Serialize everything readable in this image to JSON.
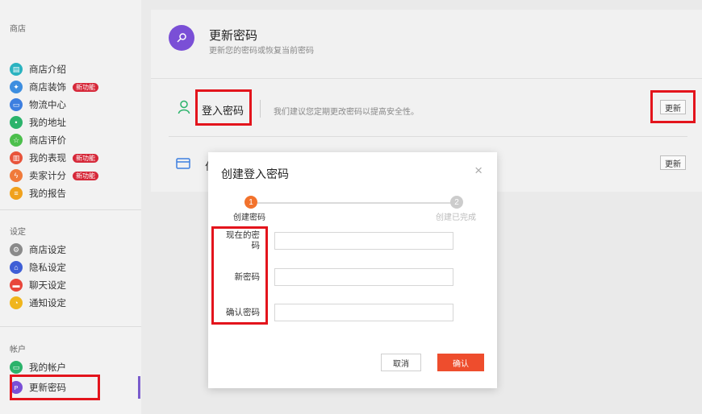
{
  "sidebar": {
    "shop_section": "商店",
    "shop_items": [
      {
        "label": "商店介绍",
        "icon": "shop-info-icon",
        "color": "#2bb3c0"
      },
      {
        "label": "商店装饰",
        "icon": "shop-decoration-icon",
        "color": "#3d8ee0",
        "badge": "新功能"
      },
      {
        "label": "物流中心",
        "icon": "logistics-icon",
        "color": "#3d7fe0"
      },
      {
        "label": "我的地址",
        "icon": "address-icon",
        "color": "#2bb36b"
      },
      {
        "label": "商店评价",
        "icon": "shop-rating-icon",
        "color": "#4cbf4c"
      },
      {
        "label": "我的表现",
        "icon": "performance-icon",
        "color": "#e8543b",
        "badge": "新功能"
      },
      {
        "label": "卖家计分",
        "icon": "seller-score-icon",
        "color": "#f07a3a",
        "badge": "新功能"
      },
      {
        "label": "我的报告",
        "icon": "report-icon",
        "color": "#f0a11c"
      }
    ],
    "settings_section": "设定",
    "settings_items": [
      {
        "label": "商店设定",
        "icon": "shop-settings-icon",
        "color": "#8a8a8a"
      },
      {
        "label": "隐私设定",
        "icon": "privacy-lock-icon",
        "color": "#3f5fd6"
      },
      {
        "label": "聊天设定",
        "icon": "chat-settings-icon",
        "color": "#e8463b"
      },
      {
        "label": "通知设定",
        "icon": "notification-settings-icon",
        "color": "#f0b51c"
      }
    ],
    "account_section": "帐户",
    "account_items": [
      {
        "label": "我的帐户",
        "icon": "account-icon",
        "color": "#2bb36b"
      },
      {
        "label": "更新密码",
        "icon": "password-key-icon",
        "color": "#7a4fd6"
      }
    ]
  },
  "header": {
    "title": "更新密码",
    "subtitle": "更新您的密码或恢复当前密码"
  },
  "login_password_row": {
    "label": "登入密码",
    "description": "我们建议您定期更改密码以提高安全性。",
    "button": "更新"
  },
  "payment_row": {
    "label_visible": "付",
    "button": "更新"
  },
  "modal": {
    "title": "创建登入密码",
    "close": "×",
    "steps": [
      {
        "number": "1",
        "label": "创建密码",
        "active": true
      },
      {
        "number": "2",
        "label": "创建已完成",
        "active": false
      }
    ],
    "fields": [
      {
        "label_line1": "现在的密",
        "label_line2": "码",
        "value": "",
        "placeholder": ""
      },
      {
        "label": "新密码",
        "value": "",
        "placeholder": ""
      },
      {
        "label": "确认密码",
        "value": "",
        "placeholder": ""
      }
    ],
    "cancel": "取消",
    "confirm": "确认"
  },
  "colors": {
    "accent": "#ee4d2d",
    "badge": "#d62839",
    "highlight_box": "#e3141c",
    "step_active": "#f2722c",
    "step_inactive": "#cccccc"
  }
}
